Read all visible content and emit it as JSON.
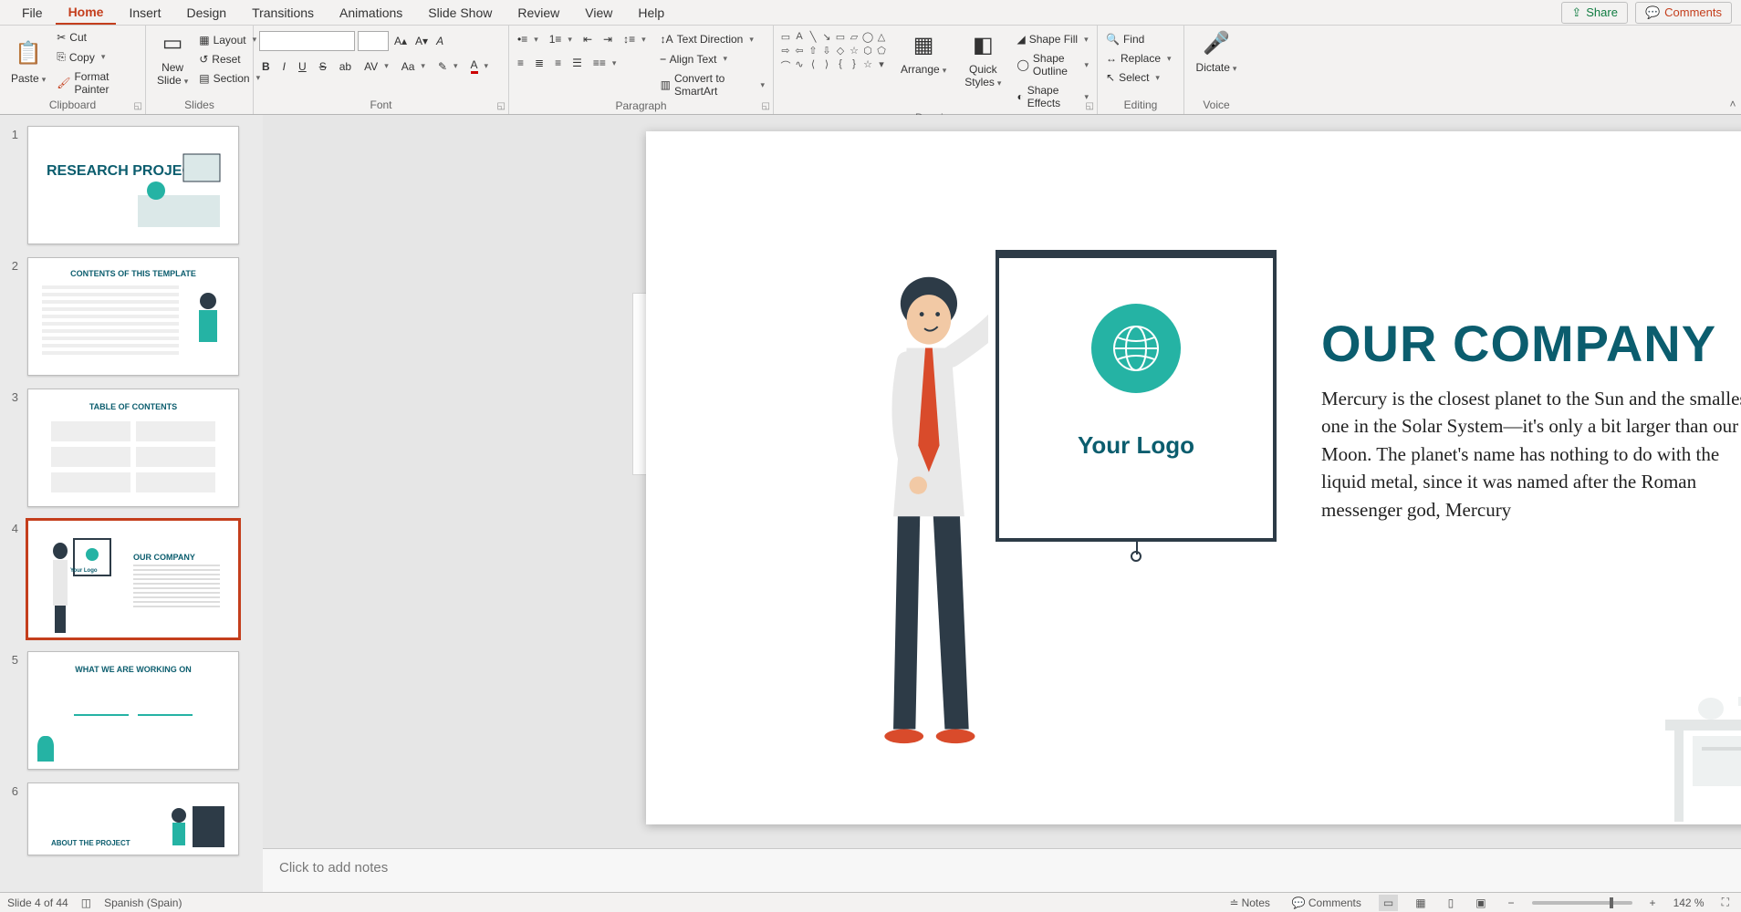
{
  "menu": {
    "tabs": [
      "File",
      "Home",
      "Insert",
      "Design",
      "Transitions",
      "Animations",
      "Slide Show",
      "Review",
      "View",
      "Help"
    ],
    "active": "Home",
    "share": "Share",
    "comments": "Comments"
  },
  "ribbon": {
    "clipboard": {
      "paste": "Paste",
      "cut": "Cut",
      "copy": "Copy",
      "format_painter": "Format Painter",
      "label": "Clipboard"
    },
    "slides": {
      "new_slide": "New\nSlide",
      "layout": "Layout",
      "reset": "Reset",
      "section": "Section",
      "label": "Slides"
    },
    "font": {
      "name_placeholder": "",
      "size_placeholder": "",
      "label": "Font"
    },
    "paragraph": {
      "text_direction": "Text Direction",
      "align_text": "Align Text",
      "smartart": "Convert to SmartArt",
      "label": "Paragraph"
    },
    "drawing": {
      "arrange": "Arrange",
      "quick_styles": "Quick\nStyles",
      "shape_fill": "Shape Fill",
      "shape_outline": "Shape Outline",
      "shape_effects": "Shape Effects",
      "label": "Drawing"
    },
    "editing": {
      "find": "Find",
      "replace": "Replace",
      "select": "Select",
      "label": "Editing"
    },
    "voice": {
      "dictate": "Dictate",
      "label": "Voice"
    }
  },
  "thumbs": [
    {
      "n": "1",
      "title": "RESEARCH PROJECT"
    },
    {
      "n": "2",
      "title": "CONTENTS OF THIS TEMPLATE"
    },
    {
      "n": "3",
      "title": "TABLE OF CONTENTS"
    },
    {
      "n": "4",
      "title": "OUR COMPANY",
      "selected": true
    },
    {
      "n": "5",
      "title": "WHAT WE ARE WORKING ON"
    },
    {
      "n": "6",
      "title": "ABOUT THE PROJECT"
    }
  ],
  "slide": {
    "title": "OUR COMPANY",
    "body": "Mercury is the closest planet to the Sun and the smallest one in the Solar System—it's only a bit larger than our Moon. The planet's name has nothing to do with the liquid metal, since it was named after the Roman messenger god, Mercury",
    "logo_label": "Your Logo"
  },
  "notes_placeholder": "Click to add notes",
  "status": {
    "slide_pos": "Slide 4 of 44",
    "language": "Spanish (Spain)",
    "notes_btn": "Notes",
    "comments_btn": "Comments",
    "zoom": "142 %"
  },
  "colors": {
    "accent": "#c43e1c",
    "brand_teal": "#0b5d6e",
    "teal_fill": "#25b3a4"
  }
}
